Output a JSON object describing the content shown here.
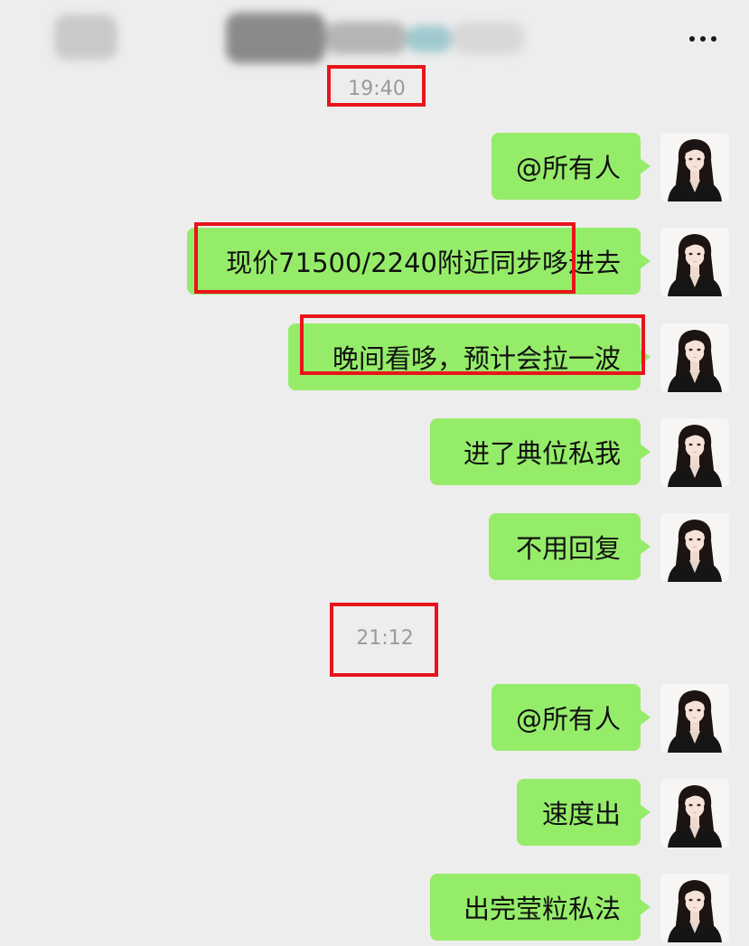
{
  "header": {
    "title_blurred": "",
    "more_icon": "more-horizontal-icon"
  },
  "timestamps": [
    "19:40",
    "21:12"
  ],
  "messages": [
    {
      "text": "@所有人"
    },
    {
      "text": "现价71500/2240附近同步哆进去"
    },
    {
      "text": "晚间看哆，预计会拉一波"
    },
    {
      "text": "进了典位私我"
    },
    {
      "text": "不用回复"
    },
    {
      "text": "@所有人"
    },
    {
      "text": "速度出"
    },
    {
      "text": "出完莹粒私法"
    }
  ],
  "colors": {
    "background": "#ededed",
    "bubble": "#95ec69",
    "highlight_box": "#e8141b",
    "timestamp": "#9a9a9a"
  }
}
